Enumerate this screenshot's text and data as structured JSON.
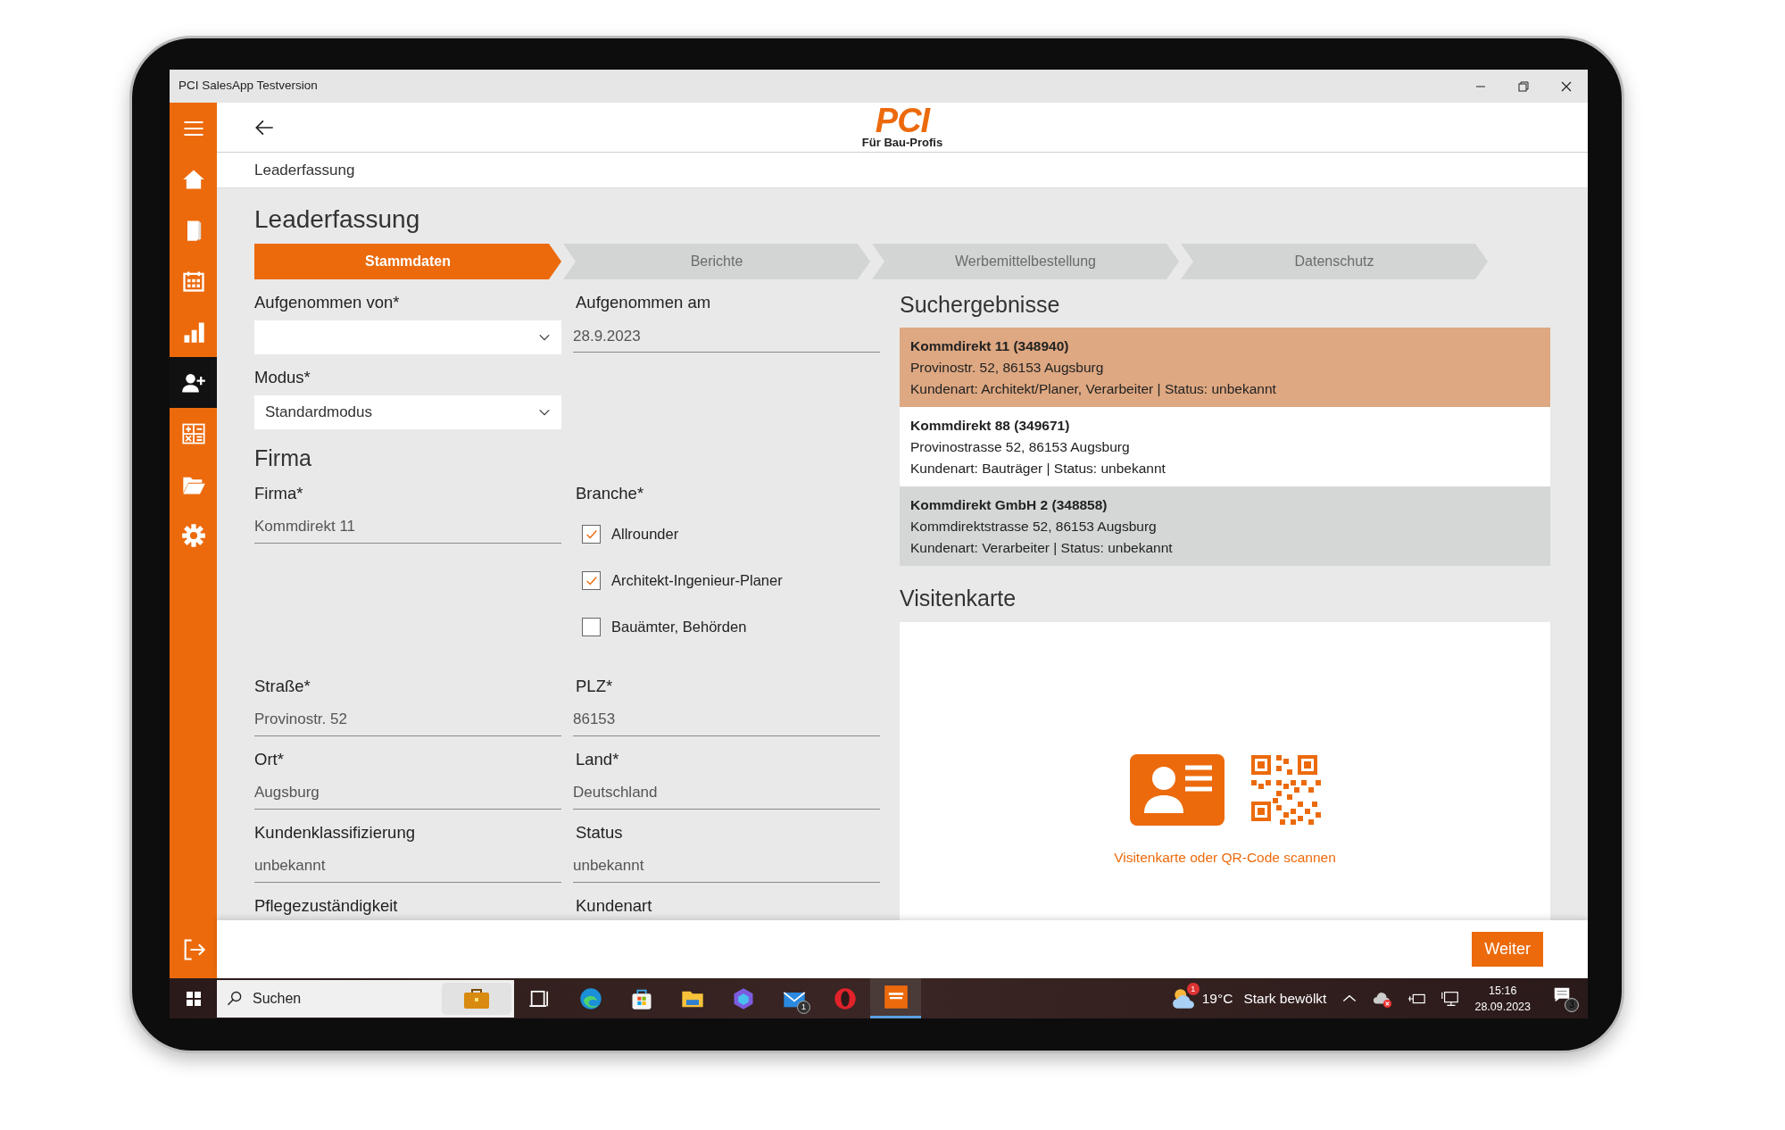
{
  "window": {
    "title": "PCI SalesApp Testversion"
  },
  "sidebar": {
    "items": [
      {
        "kind": "menu",
        "selected": false
      },
      {
        "kind": "home",
        "selected": false
      },
      {
        "kind": "book",
        "selected": false
      },
      {
        "kind": "calendar",
        "selected": false
      },
      {
        "kind": "chart",
        "selected": false
      },
      {
        "kind": "add-user",
        "selected": true
      },
      {
        "kind": "calculator",
        "selected": false
      },
      {
        "kind": "folder",
        "selected": false
      },
      {
        "kind": "settings",
        "selected": false
      }
    ],
    "bottom_items": [
      {
        "kind": "logout",
        "selected": false
      }
    ]
  },
  "header": {
    "logo": "PCI",
    "tagline": "Für Bau-Profis"
  },
  "breadcrumb": "Leaderfassung",
  "page_title": "Leaderfassung",
  "steps": [
    {
      "label": "Stammdaten",
      "selected": true
    },
    {
      "label": "Berichte",
      "selected": false
    },
    {
      "label": "Werbemittelbestellung",
      "selected": false
    },
    {
      "label": "Datenschutz",
      "selected": false
    }
  ],
  "form": [
    {
      "kind": "pair",
      "cells": [
        {
          "kind": "dropdown",
          "label": "Aufgenommen von*"
        },
        {
          "kind": "text",
          "label": "Aufgenommen am",
          "value": "28.9.2023"
        }
      ]
    },
    {
      "kind": "pair",
      "cells": [
        {
          "kind": "dropdown",
          "label": "Modus*",
          "value": "Standardmodus"
        }
      ]
    },
    {
      "kind": "heading",
      "text": "Firma"
    },
    {
      "kind": "pair",
      "cells": [
        {
          "kind": "text",
          "label": "Firma*",
          "value": "Kommdirekt 11"
        },
        {
          "kind": "checklist",
          "label": "Branche*",
          "options": [
            {
              "label": "Allrounder",
              "checked": true
            },
            {
              "label": "Architekt-Ingenieur-Planer",
              "checked": true
            },
            {
              "label": "Bauämter, Behörden",
              "checked": false
            }
          ]
        }
      ]
    },
    {
      "kind": "pair",
      "cells": [
        {
          "kind": "text",
          "label": "Straße*",
          "value": "Provinostr. 52"
        },
        {
          "kind": "text",
          "label": "PLZ*",
          "value": "86153"
        }
      ]
    },
    {
      "kind": "pair",
      "cells": [
        {
          "kind": "text",
          "label": "Ort*",
          "value": "Augsburg"
        },
        {
          "kind": "text",
          "label": "Land*",
          "value": "Deutschland"
        }
      ]
    },
    {
      "kind": "pair",
      "cells": [
        {
          "kind": "text",
          "label": "Kundenklassifizierung",
          "value": "unbekannt"
        },
        {
          "kind": "text",
          "label": "Status",
          "value": "unbekannt"
        }
      ]
    },
    {
      "kind": "pair",
      "cells": [
        {
          "kind": "label",
          "label": "Pflegezuständigkeit"
        },
        {
          "kind": "label",
          "label": "Kundenart"
        }
      ]
    }
  ],
  "results": {
    "title": "Suchergebnisse",
    "items": [
      {
        "name": "Kommdirekt 11  (348940)",
        "address": "Provinostr. 52, 86153 Augsburg",
        "details": "Kundenart: Architekt/Planer, Verarbeiter | Status: unbekannt",
        "selected": true,
        "hovered": false
      },
      {
        "name": "Kommdirekt 88  (349671)",
        "address": "Provinostrasse 52, 86153 Augsburg",
        "details": "Kundenart: Bauträger | Status: unbekannt",
        "selected": false,
        "hovered": false
      },
      {
        "name": "Kommdirekt GmbH 2  (348858)",
        "address": "Kommdirektstrasse 52, 86153 Augsburg",
        "details": "Kundenart: Verarbeiter | Status: unbekannt",
        "selected": false,
        "hovered": true
      }
    ]
  },
  "business_card": {
    "title": "Visitenkarte",
    "hint": "Visitenkarte oder QR-Code scannen"
  },
  "footer": {
    "button": "Weiter"
  },
  "taskbar": {
    "search_placeholder": "Suchen",
    "apps": [
      {
        "kind": "taskview",
        "selected": false
      },
      {
        "kind": "edge",
        "selected": false
      },
      {
        "kind": "store",
        "selected": false
      },
      {
        "kind": "explorer",
        "selected": false
      },
      {
        "kind": "copilot",
        "selected": false
      },
      {
        "kind": "mail",
        "selected": false,
        "badge": "1"
      },
      {
        "kind": "opera",
        "selected": false
      },
      {
        "kind": "pci",
        "selected": true
      }
    ],
    "weather_badge": "1",
    "temperature": "19°C",
    "weather": "Stark bewölkt",
    "time": "15:16",
    "date": "28.09.2023",
    "notifications": "3"
  }
}
